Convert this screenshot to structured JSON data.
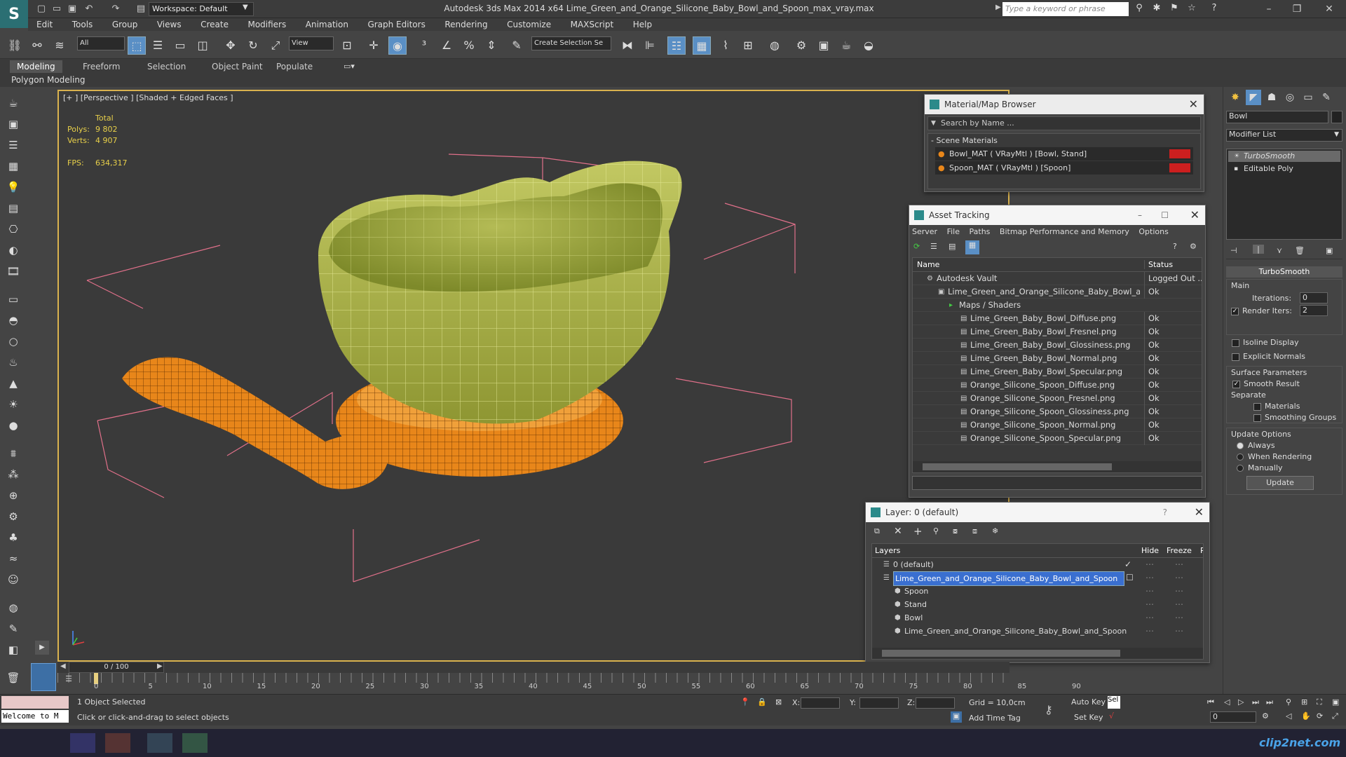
{
  "titlebar": {
    "logo_letter": "S",
    "workspace": "Workspace: Default",
    "app_title": "Autodesk 3ds Max  2014 x64     Lime_Green_and_Orange_Silicone_Baby_Bowl_and_Spoon_max_vray.max",
    "search_placeholder": "Type a keyword or phrase"
  },
  "menu": [
    "Edit",
    "Tools",
    "Group",
    "Views",
    "Create",
    "Modifiers",
    "Animation",
    "Graph Editors",
    "Rendering",
    "Customize",
    "MAXScript",
    "Help"
  ],
  "toolbar": {
    "selection_filter": "All",
    "ref_coord": "View",
    "selection_set_placeholder": "Create Selection Se"
  },
  "ribbon": {
    "tabs": [
      "Modeling",
      "Freeform",
      "Selection",
      "Object Paint",
      "Populate"
    ],
    "active_tab": "Modeling",
    "panel_label": "Polygon Modeling"
  },
  "viewport": {
    "label": "[+ ] [Perspective ] [Shaded + Edged Faces ]",
    "stats_header": "Total",
    "polys_label": "Polys:",
    "polys_value": "9 802",
    "verts_label": "Verts:",
    "verts_value": "4 907",
    "fps_label": "FPS:",
    "fps_value": "634,317"
  },
  "material_browser": {
    "title": "Material/Map Browser",
    "search_placeholder": "Search by Name ...",
    "group": "- Scene Materials",
    "items": [
      "Bowl_MAT  ( VRayMtl ) [Bowl, Stand]",
      "Spoon_MAT  ( VRayMtl ) [Spoon]"
    ]
  },
  "asset_tracking": {
    "title": "Asset Tracking",
    "menu": [
      "Server",
      "File",
      "Paths",
      "Bitmap Performance and Memory",
      "Options"
    ],
    "col_name": "Name",
    "col_status": "Status",
    "rows": [
      {
        "name": "Autodesk Vault",
        "status": "Logged Out ..."
      },
      {
        "name": "Lime_Green_and_Orange_Silicone_Baby_Bowl_an...",
        "status": "Ok"
      },
      {
        "name": "Maps / Shaders",
        "status": ""
      },
      {
        "name": "Lime_Green_Baby_Bowl_Diffuse.png",
        "status": "Ok"
      },
      {
        "name": "Lime_Green_Baby_Bowl_Fresnel.png",
        "status": "Ok"
      },
      {
        "name": "Lime_Green_Baby_Bowl_Glossiness.png",
        "status": "Ok"
      },
      {
        "name": "Lime_Green_Baby_Bowl_Normal.png",
        "status": "Ok"
      },
      {
        "name": "Lime_Green_Baby_Bowl_Specular.png",
        "status": "Ok"
      },
      {
        "name": "Orange_Silicone_Spoon_Diffuse.png",
        "status": "Ok"
      },
      {
        "name": "Orange_Silicone_Spoon_Fresnel.png",
        "status": "Ok"
      },
      {
        "name": "Orange_Silicone_Spoon_Glossiness.png",
        "status": "Ok"
      },
      {
        "name": "Orange_Silicone_Spoon_Normal.png",
        "status": "Ok"
      },
      {
        "name": "Orange_Silicone_Spoon_Specular.png",
        "status": "Ok"
      }
    ]
  },
  "layer_window": {
    "title": "Layer: 0 (default)",
    "help": "?",
    "col_layers": "Layers",
    "col_hide": "Hide",
    "col_freeze": "Freeze",
    "col_r": "R",
    "rows": [
      "0 (default)",
      "Lime_Green_and_Orange_Silicone_Baby_Bowl_and_Spoon",
      "Spoon",
      "Stand",
      "Bowl",
      "Lime_Green_and_Orange_Silicone_Baby_Bowl_and_Spoon"
    ]
  },
  "command_panel": {
    "object_name": "Bowl",
    "modifier_list": "Modifier List",
    "stack": [
      "TurboSmooth",
      "Editable Poly"
    ],
    "rollout_title": "TurboSmooth",
    "main_label": "Main",
    "iterations_label": "Iterations:",
    "iterations_value": "0",
    "render_iters_label": "Render Iters:",
    "render_iters_value": "2",
    "isoline": "Isoline Display",
    "explicit_normals": "Explicit Normals",
    "surface_params": "Surface Parameters",
    "smooth_result": "Smooth Result",
    "separate": "Separate",
    "materials": "Materials",
    "smoothing_groups": "Smoothing Groups",
    "update_options": "Update Options",
    "always": "Always",
    "when_rendering": "When Rendering",
    "manually": "Manually",
    "update_btn": "Update"
  },
  "timeline": {
    "frame_counter": "0 / 100",
    "ticks": [
      "0",
      "5",
      "10",
      "15",
      "20",
      "25",
      "30",
      "35",
      "40",
      "45",
      "50",
      "55",
      "60",
      "65",
      "70",
      "75",
      "80",
      "85",
      "90"
    ]
  },
  "status": {
    "maxscript": "Welcome to M",
    "selection": "1 Object Selected",
    "prompt": "Click or click-and-drag to select objects",
    "x_label": "X:",
    "y_label": "Y:",
    "z_label": "Z:",
    "grid": "Grid = 10,0cm",
    "add_time_tag": "Add Time Tag",
    "auto_key": "Auto Key",
    "set_key": "Set Key",
    "sel": "Sel",
    "frame": "0"
  },
  "watermark": "clip2net.com",
  "colors": {
    "viewport_border": "#d9b24e",
    "bowl": "#a8b040",
    "spoon": "#e8861a",
    "selection_highlight": "#3a6fd0",
    "material_swatch": "#cc1f1f"
  }
}
